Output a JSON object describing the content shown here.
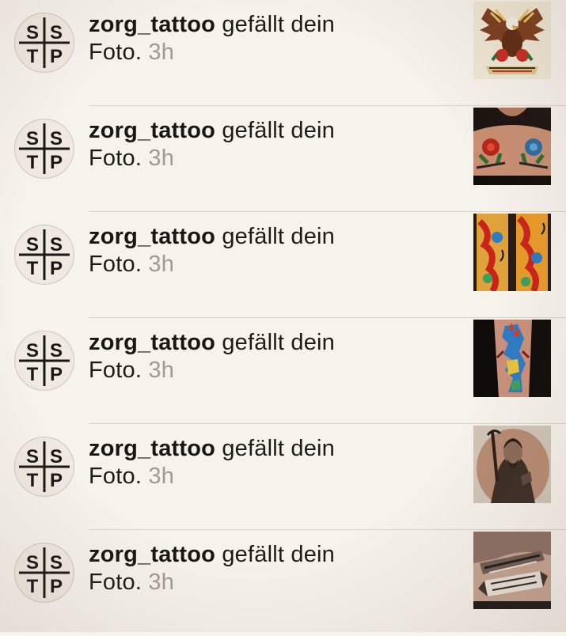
{
  "notifications": [
    {
      "avatar_letters": [
        "S",
        "S",
        "T",
        "P"
      ],
      "username": "zorg_tattoo",
      "action_line1": "gefällt dein",
      "action_line2": "Foto.",
      "time": "3h",
      "thumbnail": "eagle-flash-tattoo-photo"
    },
    {
      "avatar_letters": [
        "S",
        "S",
        "T",
        "P"
      ],
      "username": "zorg_tattoo",
      "action_line1": "gefällt dein",
      "action_line2": "Foto.",
      "time": "3h",
      "thumbnail": "chest-roses-tattoo-photo"
    },
    {
      "avatar_letters": [
        "S",
        "S",
        "T",
        "P"
      ],
      "username": "zorg_tattoo",
      "action_line1": "gefällt dein",
      "action_line2": "Foto.",
      "time": "3h",
      "thumbnail": "koi-sleeve-tattoo-photo"
    },
    {
      "avatar_letters": [
        "S",
        "S",
        "T",
        "P"
      ],
      "username": "zorg_tattoo",
      "action_line1": "gefällt dein",
      "action_line2": "Foto.",
      "time": "3h",
      "thumbnail": "side-piece-tattoo-photo"
    },
    {
      "avatar_letters": [
        "S",
        "S",
        "T",
        "P"
      ],
      "username": "zorg_tattoo",
      "action_line1": "gefällt dein",
      "action_line2": "Foto.",
      "time": "3h",
      "thumbnail": "portrait-tattoo-photo"
    },
    {
      "avatar_letters": [
        "S",
        "S",
        "T",
        "P"
      ],
      "username": "zorg_tattoo",
      "action_line1": "gefällt dein",
      "action_line2": "Foto.",
      "time": "3h",
      "thumbnail": "razor-banner-tattoo-photo"
    }
  ],
  "colors": {
    "background": "#f6f2ec",
    "text": "#1e1a17",
    "timestamp": "#a29a91",
    "divider": "#d9d3cb"
  }
}
